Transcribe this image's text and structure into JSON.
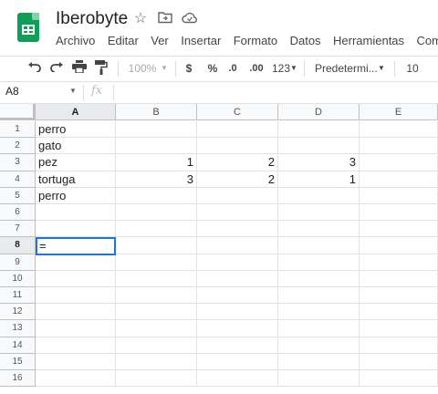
{
  "header": {
    "title": "Iberobyte",
    "icons": [
      "star-icon",
      "move-to-folder-icon",
      "cloud-saved-icon"
    ]
  },
  "menu": [
    "Archivo",
    "Editar",
    "Ver",
    "Insertar",
    "Formato",
    "Datos",
    "Herramientas",
    "Comple"
  ],
  "toolbar": {
    "zoom": "100%",
    "currency": "$",
    "percent": "%",
    "decrease_decimals": ".0",
    "increase_decimals": ".00",
    "more_formats": "123",
    "font": "Predetermi...",
    "font_size": "10"
  },
  "formula_bar": {
    "cell_ref": "A8",
    "fx_label": "fx",
    "content": ""
  },
  "grid": {
    "columns": [
      "A",
      "B",
      "C",
      "D",
      "E"
    ],
    "rows": [
      {
        "num": "1",
        "cells": [
          "perro",
          "",
          "",
          "",
          ""
        ]
      },
      {
        "num": "2",
        "cells": [
          "gato",
          "",
          "",
          "",
          ""
        ]
      },
      {
        "num": "3",
        "cells": [
          "pez",
          "1",
          "2",
          "3",
          ""
        ]
      },
      {
        "num": "4",
        "cells": [
          "tortuga",
          "3",
          "2",
          "1",
          ""
        ]
      },
      {
        "num": "5",
        "cells": [
          "perro",
          "",
          "",
          "",
          ""
        ]
      },
      {
        "num": "6",
        "cells": [
          "",
          "",
          "",
          "",
          ""
        ]
      },
      {
        "num": "7",
        "cells": [
          "",
          "",
          "",
          "",
          ""
        ]
      },
      {
        "num": "8",
        "cells": [
          "=",
          "",
          "",
          "",
          ""
        ]
      },
      {
        "num": "9",
        "cells": [
          "",
          "",
          "",
          "",
          ""
        ]
      },
      {
        "num": "10",
        "cells": [
          "",
          "",
          "",
          "",
          ""
        ]
      },
      {
        "num": "11",
        "cells": [
          "",
          "",
          "",
          "",
          ""
        ]
      },
      {
        "num": "12",
        "cells": [
          "",
          "",
          "",
          "",
          ""
        ]
      },
      {
        "num": "13",
        "cells": [
          "",
          "",
          "",
          "",
          ""
        ]
      },
      {
        "num": "14",
        "cells": [
          "",
          "",
          "",
          "",
          ""
        ]
      },
      {
        "num": "15",
        "cells": [
          "",
          "",
          "",
          "",
          ""
        ]
      },
      {
        "num": "16",
        "cells": [
          "",
          "",
          "",
          "",
          ""
        ]
      }
    ],
    "active_cell_value": "=",
    "selection_color": "#1a73e8"
  }
}
